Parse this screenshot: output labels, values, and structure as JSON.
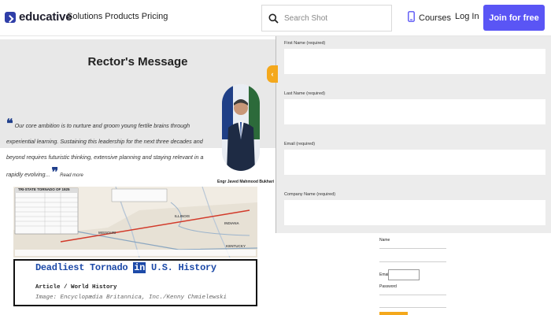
{
  "header": {
    "brand": "educative",
    "nav": "Solutions Products Pricing",
    "search_placeholder": "Search Shot",
    "courses_label": "Courses",
    "login_label": "Log In",
    "join_label": "Join for free"
  },
  "rector": {
    "title": "Rector's Message",
    "quote": "Our core ambition is to nurture and groom young fertile brains through experiential learning. Sustaining this leadership for the next three decades and beyond requires futuristic thinking, extensive planning and staying relevant in a rapidly evolving...",
    "read_more": "Read more",
    "portrait_caption": "Engr Javed Mahmood Bukhari"
  },
  "form_panel": {
    "collapse_glyph": "‹",
    "fields": [
      {
        "label": "First Name (required)"
      },
      {
        "label": "Last Name (required)"
      },
      {
        "label": "Email (required)"
      },
      {
        "label": "Company Name (required)"
      }
    ]
  },
  "article": {
    "map_table_title": "TRI-STATE TORNADO OF 1925",
    "map_states": [
      "ILLINOIS",
      "INDIANA",
      "MISSOURI",
      "KENTUCKY"
    ],
    "title_part1": "Deadliest Tornado",
    "title_in": "in",
    "title_part2": "U.S. History",
    "subtitle": "Article / World History",
    "credit": "Image: Encyclopædia Britannica, Inc./Kenny Chmielewski"
  },
  "login_form": {
    "name_label": "Name",
    "email_label": "Email",
    "password_label": "Password"
  },
  "colors": {
    "brand_blue": "#5a55f5",
    "handle_orange": "#f4a81c",
    "title_blue": "#1d4aa8",
    "tornado_path": "#d23a2a"
  }
}
